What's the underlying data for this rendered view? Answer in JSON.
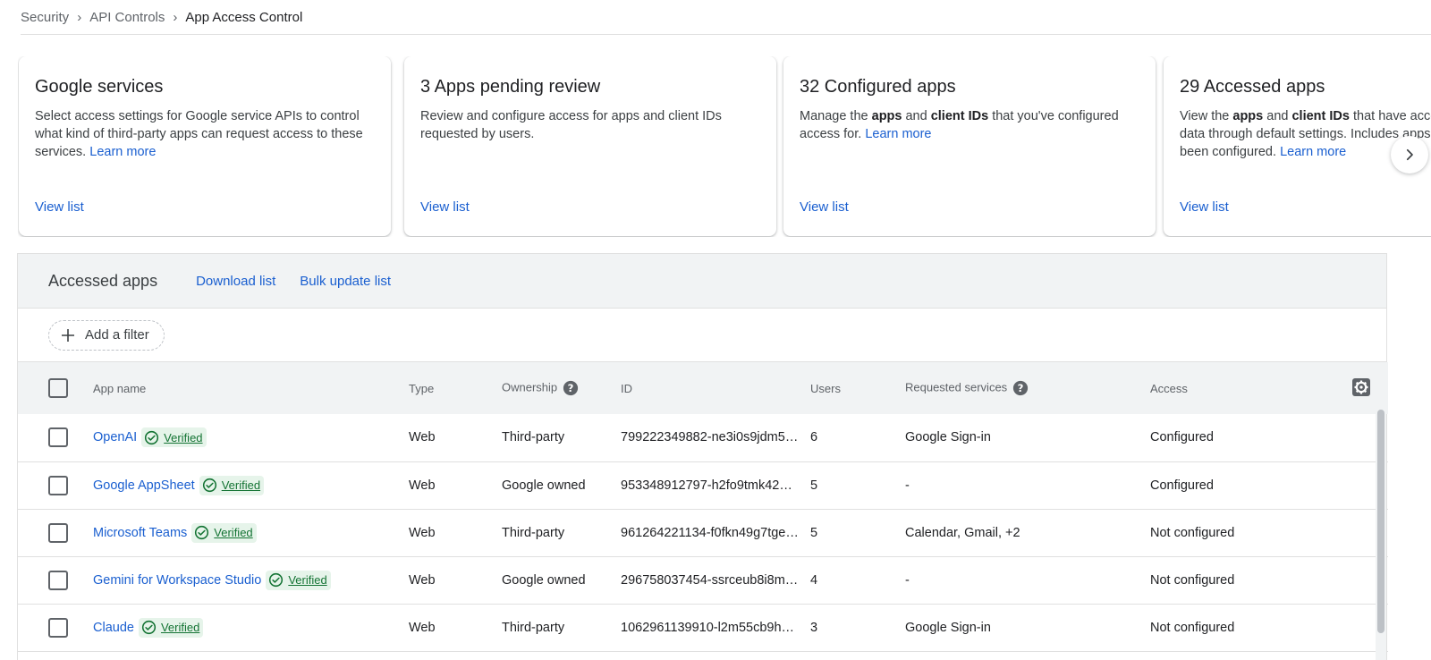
{
  "breadcrumb": [
    "Security",
    "API Controls",
    "App Access Control"
  ],
  "cards": [
    {
      "title": "Google services",
      "desc": "Select access settings for Google service APIs to control what kind of third-party apps can request access to these services.",
      "learn_more": "Learn more",
      "link": "View list"
    },
    {
      "title": "3 Apps pending review",
      "desc": "Review and configure access for apps and client IDs requested by users.",
      "link": "View list"
    },
    {
      "title": "32 Configured apps",
      "desc_pre": "Manage the ",
      "desc_b1": "apps",
      "desc_mid": " and ",
      "desc_b2": "client IDs",
      "desc_post": " that you've configured access for.",
      "learn_more": "Learn more",
      "link": "View list"
    },
    {
      "title": "29 Accessed apps",
      "desc_pre": "View the ",
      "desc_b1": "apps",
      "desc_mid": " and ",
      "desc_b2": "client IDs",
      "desc_post": " that have accessed Google data through default settings. Includes apps that have been configured.",
      "learn_more": "Learn more",
      "link": "View list"
    }
  ],
  "panel": {
    "title": "Accessed apps",
    "download": "Download list",
    "bulk": "Bulk update list",
    "filter": "Add a filter"
  },
  "table": {
    "headers": {
      "name": "App name",
      "type": "Type",
      "ownership": "Ownership",
      "id": "ID",
      "users": "Users",
      "services": "Requested services",
      "access": "Access"
    },
    "verified_label": "Verified",
    "rows": [
      {
        "name": "OpenAI",
        "type": "Web",
        "ownership": "Third-party",
        "id": "799222349882-ne3i0s9jdm5…",
        "users": "6",
        "services": "Google Sign-in",
        "access": "Configured"
      },
      {
        "name": "Google AppSheet",
        "type": "Web",
        "ownership": "Google owned",
        "id": "953348912797-h2fo9tmk42…",
        "users": "5",
        "services": "-",
        "access": "Configured"
      },
      {
        "name": "Microsoft Teams",
        "type": "Web",
        "ownership": "Third-party",
        "id": "961264221134-f0fkn49g7tge…",
        "users": "5",
        "services": "Calendar, Gmail, +2",
        "access": "Not configured"
      },
      {
        "name": "Gemini for Workspace Studio",
        "type": "Web",
        "ownership": "Google owned",
        "id": "296758037454-ssrceub8i8m…",
        "users": "4",
        "services": "-",
        "access": "Not configured"
      },
      {
        "name": "Claude",
        "type": "Web",
        "ownership": "Third-party",
        "id": "1062961139910-l2m55cb9h…",
        "users": "3",
        "services": "Google Sign-in",
        "access": "Not configured"
      }
    ]
  }
}
